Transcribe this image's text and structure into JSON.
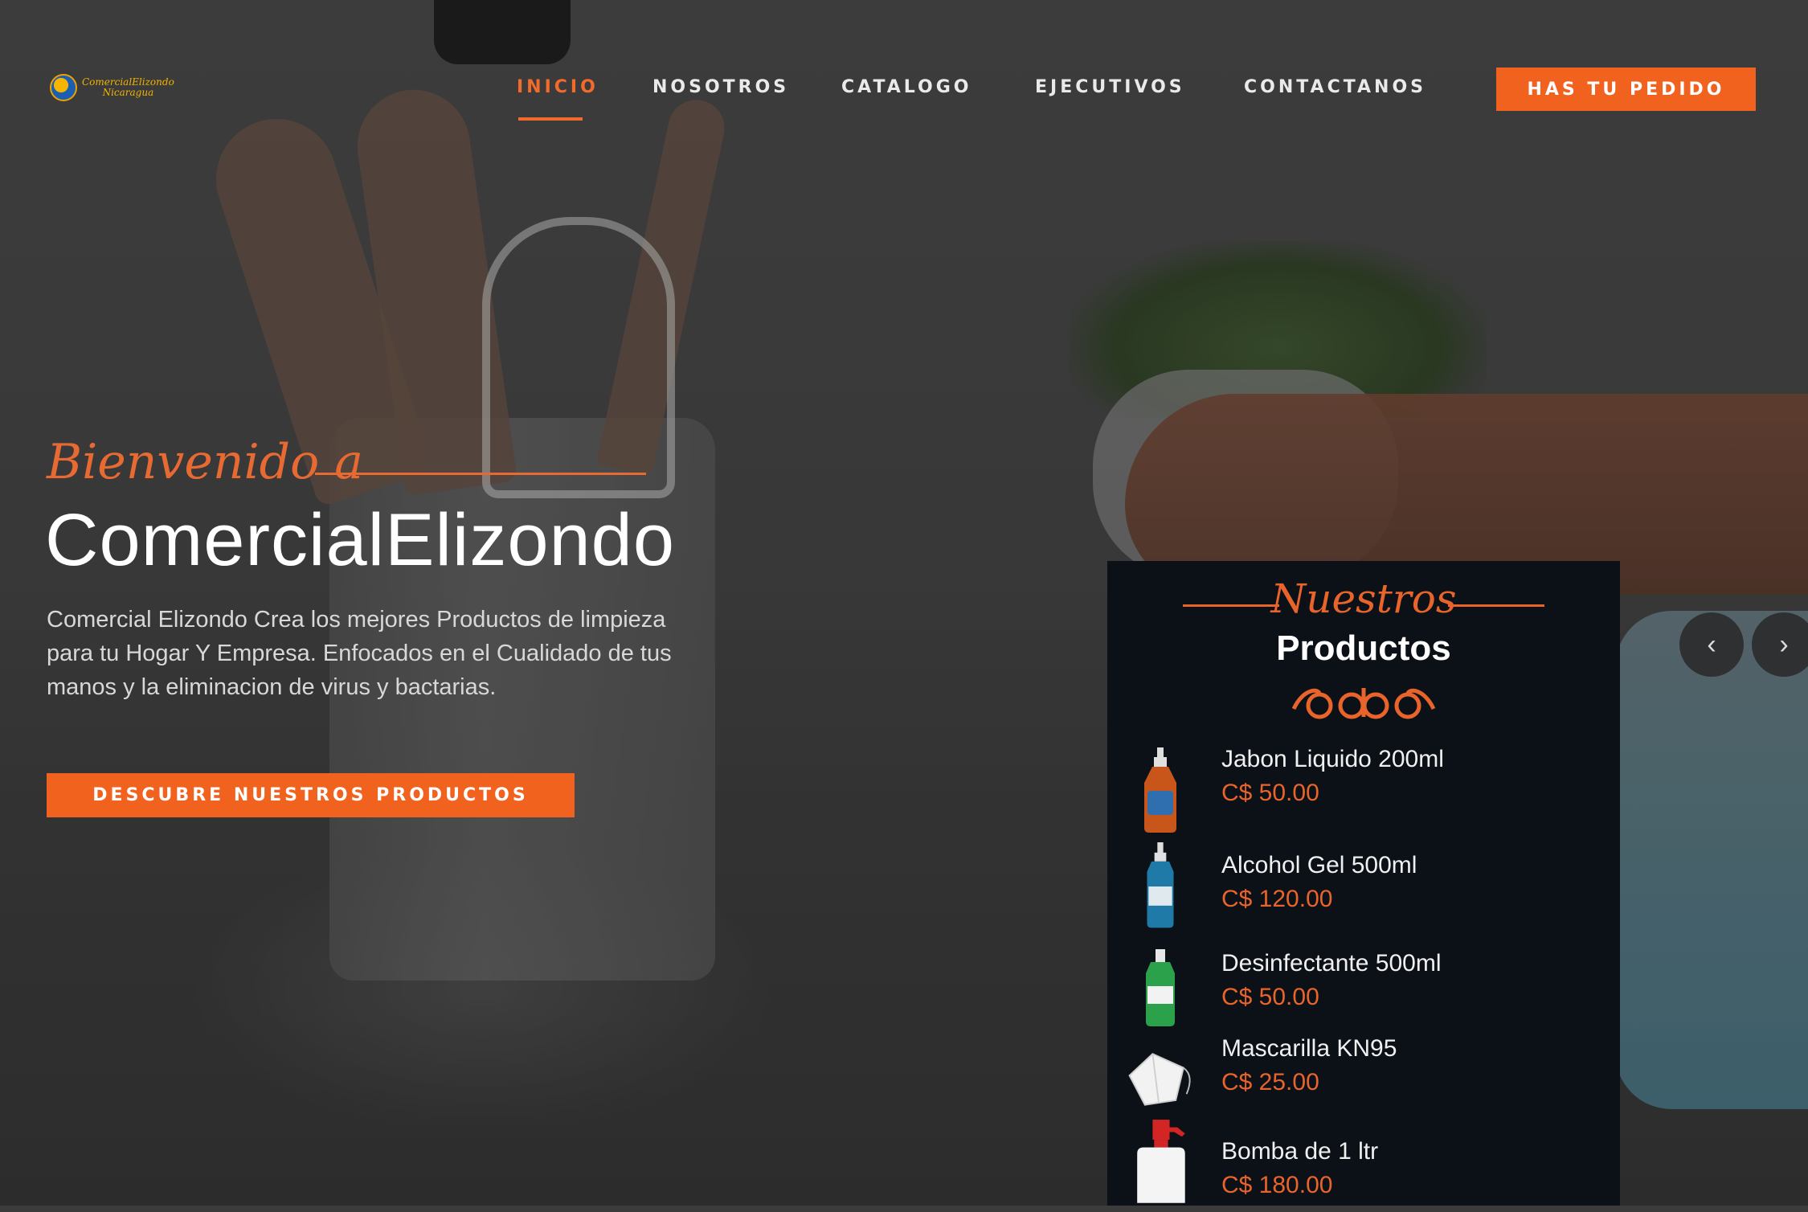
{
  "header": {
    "logo_text": "ComercialElizondo",
    "logo_subtext": "Nicaragua",
    "nav": [
      {
        "label": "INICIO",
        "active": true
      },
      {
        "label": "NOSOTROS",
        "active": false
      },
      {
        "label": "CATALOGO",
        "active": false
      },
      {
        "label": "EJECUTIVOS",
        "active": false
      },
      {
        "label": "CONTACTANOS",
        "active": false
      }
    ],
    "order_button": "HAS TU PEDIDO"
  },
  "hero": {
    "welcome": "Bienvenido a",
    "brand": "ComercialElizondo",
    "description": "Comercial Elizondo Crea los mejores Productos de limpieza para tu Hogar Y Empresa. Enfocados en el Cualidado de tus manos y la eliminacion de virus y bactarias.",
    "cta": "DESCUBRE NUESTROS PRODUCTOS"
  },
  "products": {
    "script_title": "Nuestros",
    "title": "Productos",
    "items": [
      {
        "name": "Jabon Liquido 200ml",
        "price": "C$ 50.00",
        "icon": "orange-soap-bottle"
      },
      {
        "name": "Alcohol Gel 500ml",
        "price": "C$ 120.00",
        "icon": "blue-gel-bottle"
      },
      {
        "name": "Desinfectante 500ml",
        "price": "C$ 50.00",
        "icon": "green-disinfectant-bottle"
      },
      {
        "name": "Mascarilla KN95",
        "price": "C$ 25.00",
        "icon": "kn95-mask"
      },
      {
        "name": "Bomba de 1 ltr",
        "price": "C$ 180.00",
        "icon": "spray-pump"
      }
    ]
  },
  "slider": {
    "prev_icon": "chevron-left",
    "next_icon": "chevron-right"
  },
  "colors": {
    "accent": "#f2621f",
    "panel_bg": "#0c1118",
    "text": "#ffffff"
  }
}
